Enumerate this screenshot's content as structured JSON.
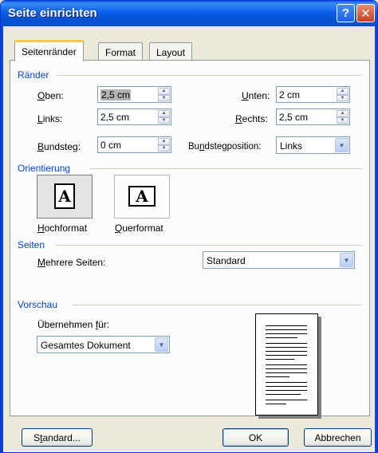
{
  "window": {
    "title": "Seite einrichten",
    "help_glyph": "?",
    "close_glyph": "✕"
  },
  "tabs": [
    {
      "label": "Seitenränder",
      "active": true
    },
    {
      "label": "Format",
      "active": false
    },
    {
      "label": "Layout",
      "active": false
    }
  ],
  "margins": {
    "section_label": "Ränder",
    "top": {
      "label": "Oben:",
      "hotkey": "O",
      "rest": "ben:",
      "value": "2,5 cm"
    },
    "left": {
      "label": "Links:",
      "hotkey": "L",
      "rest": "inks:",
      "value": "2,5 cm"
    },
    "gutter": {
      "label": "Bundsteg:",
      "hotkey": "B",
      "rest": "undsteg:",
      "value": "0 cm"
    },
    "bottom": {
      "label": "Unten:",
      "hotkey": "U",
      "rest": "nten:",
      "value": "2 cm"
    },
    "right": {
      "label": "Rechts:",
      "hotkey": "R",
      "rest": "echts:",
      "value": "2,5 cm"
    },
    "gutter_position": {
      "label": "Bundstegposition:",
      "pre": "Bu",
      "hotkey": "n",
      "rest": "dstegposition:",
      "value": "Links"
    }
  },
  "orientation": {
    "section_label": "Orientierung",
    "portrait": {
      "label": "Hochformat",
      "hotkey": "H",
      "rest": "ochformat",
      "glyph": "A",
      "selected": true
    },
    "landscape": {
      "label": "Querformat",
      "hotkey": "Q",
      "rest": "uerformat",
      "glyph": "A",
      "selected": false
    }
  },
  "pages": {
    "section_label": "Seiten",
    "multiple_pages": {
      "label": "Mehrere Seiten:",
      "hotkey": "M",
      "rest": "ehrere Seiten:",
      "value": "Standard"
    }
  },
  "preview": {
    "section_label": "Vorschau",
    "apply_to": {
      "label": "Übernehmen für:",
      "pre": "Übernehmen ",
      "hotkey": "f",
      "rest": "ür:",
      "value": "Gesamtes Dokument"
    }
  },
  "footer": {
    "default_button": {
      "label": "Standard...",
      "pre": "S",
      "hotkey": "t",
      "rest": "andard..."
    },
    "ok_button": "OK",
    "cancel_button": "Abbrechen"
  }
}
